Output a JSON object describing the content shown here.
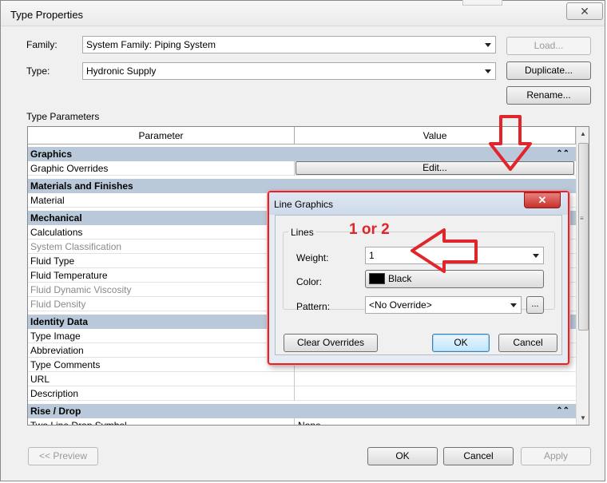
{
  "window": {
    "title": "Type Properties",
    "close_glyph": "✕"
  },
  "family": {
    "label": "Family:",
    "value": "System Family: Piping System"
  },
  "type": {
    "label": "Type:",
    "value": "Hydronic Supply"
  },
  "buttons": {
    "load": "Load...",
    "duplicate": "Duplicate...",
    "rename": "Rename..."
  },
  "type_parameters_label": "Type Parameters",
  "grid": {
    "headers": {
      "parameter": "Parameter",
      "value": "Value"
    },
    "groups": {
      "graphics": "Graphics",
      "materials": "Materials and Finishes",
      "mechanical": "Mechanical",
      "identity": "Identity Data",
      "rise_drop": "Rise / Drop"
    },
    "group_chevron": "⌃⌃",
    "rows": {
      "graphic_overrides": "Graphic Overrides",
      "edit_button": "Edit...",
      "material": "Material",
      "calculations": "Calculations",
      "system_classification": "System Classification",
      "fluid_type": "Fluid Type",
      "fluid_temperature": "Fluid Temperature",
      "fluid_dynamic_viscosity": "Fluid Dynamic Viscosity",
      "fluid_density": "Fluid Density",
      "type_image": "Type Image",
      "abbreviation": "Abbreviation",
      "type_comments": "Type Comments",
      "url": "URL",
      "description": "Description",
      "two_line_drop_symbol": "Two Line Drop Symbol",
      "two_line_drop_symbol_value": "None"
    }
  },
  "footer": {
    "preview": "<< Preview",
    "ok": "OK",
    "cancel": "Cancel",
    "apply": "Apply"
  },
  "line_graphics": {
    "title": "Line Graphics",
    "lines_group": "Lines",
    "weight_label": "Weight:",
    "weight_value": "1",
    "color_label": "Color:",
    "color_value": "Black",
    "pattern_label": "Pattern:",
    "pattern_value": "<No Override>",
    "ellipsis": "...",
    "clear_overrides": "Clear Overrides",
    "ok": "OK",
    "cancel": "Cancel"
  },
  "annotation": {
    "text": "1 or 2"
  },
  "colors": {
    "group_header": "#b9c9da",
    "annotation_red": "#e0252b",
    "dialog_bg": "#e6ecf3"
  }
}
